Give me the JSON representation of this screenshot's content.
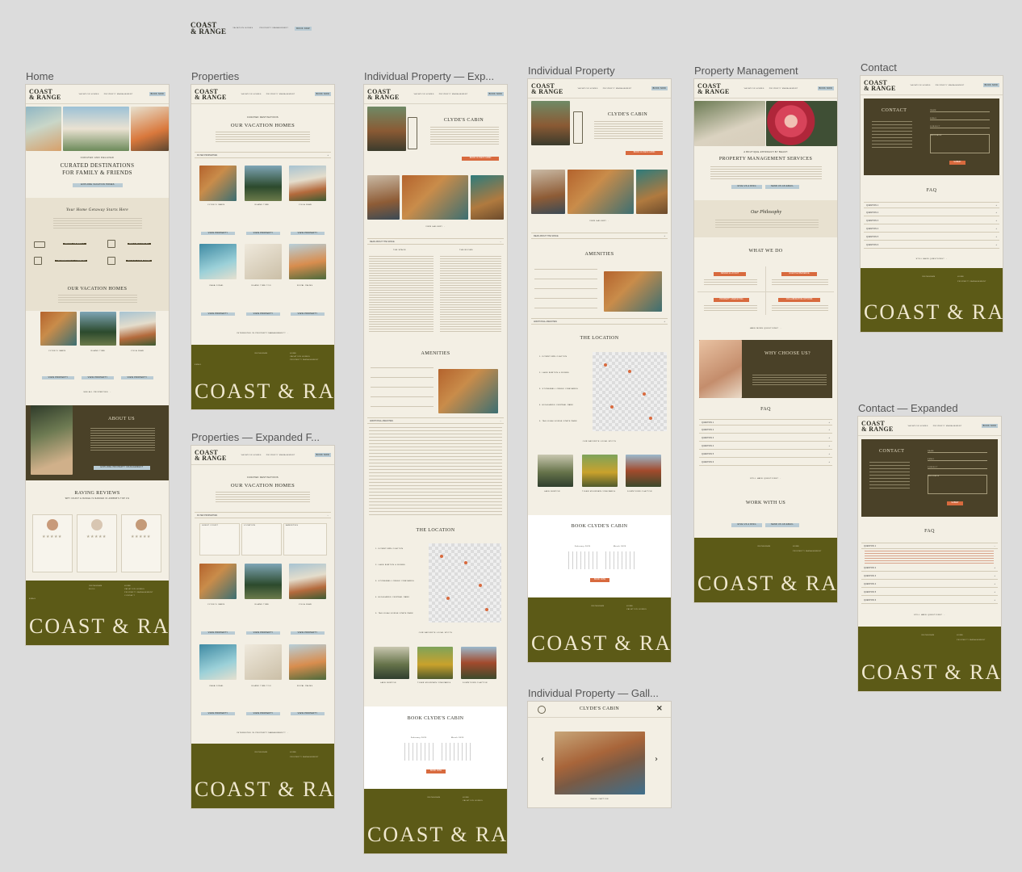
{
  "brand": {
    "logo_line1": "COAST",
    "logo_line2": "& RANGE"
  },
  "top_nav": {
    "links": [
      "VACATION HOMES",
      "PROPERTY MANAGEMENT"
    ],
    "book_now": "BOOK NOW"
  },
  "frames": [
    {
      "label": "Home"
    },
    {
      "label": "Properties"
    },
    {
      "label": "Individual Property — Exp..."
    },
    {
      "label": "Individual Property"
    },
    {
      "label": "Property Management"
    },
    {
      "label": "Contact"
    },
    {
      "label": "Properties — Expanded F..."
    },
    {
      "label": "Individual Property — Gall..."
    },
    {
      "label": "Contact — Expanded"
    }
  ],
  "home": {
    "eyebrow": "CURATED AND RELAXED",
    "hero_title_1": "CURATED DESTINATIONS",
    "hero_title_2": "FOR FAMILY & FRIENDS",
    "hero_cta": "EXPLORE VACATION HOMES",
    "script_line": "Your Home Getaway Starts Here",
    "features": [
      "GROUP FRIENDLY",
      "PET FRIENDLY",
      "WELL APPOINTED",
      "THOUGHTFULLY CURATED",
      "STELLAR HOSTS",
      "IDYLLIC LOCATIONS"
    ],
    "homes_title": "OUR VACATION HOMES",
    "view_all": "SEE ALL PROPERTIES →",
    "about_title": "ABOUT US",
    "about_cta": "EXPLORE PROPERTY MANAGEMENT",
    "reviews_title": "RAVING REVIEWS",
    "reviews_sub": "WHY COAST & RANGE IS RANKED IN AIRBNB'S TOP 1%",
    "stars": "★★★★★"
  },
  "properties": {
    "eyebrow": "CURATED DESTINATIONS",
    "title": "OUR VACATION HOMES",
    "filter": "FILTER PROPERTIES",
    "filter_columns": [
      "GUEST COUNT",
      "LOCATION",
      "AMENITIES"
    ],
    "cards": [
      "CLYDE'S CABIN",
      "ISLAND TIME",
      "VILLA JEAN",
      "CASA CORAL",
      "ISLAND TIME TOO",
      "ROYAL PALMS"
    ],
    "view_property": "VIEW PROPERTY",
    "pm_link": "INTERESTED IN PROPERTY MANAGEMENT? →"
  },
  "property": {
    "title": "CLYDE'S CABIN",
    "book_cta": "BOOK CLYDE'S CABIN",
    "gallery_link": "VIEW GALLERY →",
    "read_about": "READ ABOUT THE SPACE",
    "the_space": "THE SPACE",
    "the_rooms": "THE ROOMS",
    "amenities_title": "AMENITIES",
    "additional_amenities": "ADDITIONAL AMENITIES",
    "location_title": "THE LOCATION",
    "locations": [
      "1. DOWNTOWN CLAYTON",
      "2. LAKE BURTON & ROBBS",
      "3. STONEWALL CREEK VINEYARDS",
      "4. HIGHLANDS CENTRAL PARK",
      "5. TALLULAH GORGE STATE PARK"
    ],
    "favorite_spots": "OUR FAVORITE LOCAL SPOTS",
    "spots": [
      "LAKE BURTON",
      "TIGER MOUNTAIN VINEYARDS",
      "DOWNTOWN CLAYTON"
    ],
    "book_title": "BOOK CLYDE'S CABIN",
    "months": [
      "February 2025",
      "March 2025"
    ],
    "book_btn": "BOOK NOW"
  },
  "pm": {
    "eyebrow": "A BOUTIQUE APPROACH BY BEACH",
    "title": "PROPERTY MANAGEMENT SERVICES",
    "cta_1": "GIVE US A RING",
    "cta_2": "SEND US AN EMAIL",
    "philosophy": "Our Philosophy",
    "what_we_do": "WHAT WE DO",
    "services": [
      "DESIGN & LAYOUT",
      "GUEST EXPERIENCE",
      "PROPERTY MARKETING",
      "COLLABORATIVE OPTIONS"
    ],
    "more_questions": "HAVE MORE QUESTIONS? →",
    "why_title": "WHY CHOOSE US?",
    "faq": "FAQ",
    "questions": [
      "QUESTION 1",
      "QUESTION 2",
      "QUESTION 3",
      "QUESTION 4",
      "QUESTION 5",
      "QUESTION 6"
    ],
    "still_questions": "STILL HAVE QUESTIONS? →",
    "work_with_us": "WORK WITH US"
  },
  "contact": {
    "title": "CONTACT",
    "fields": [
      "NAME",
      "EMAIL",
      "SUBJECT",
      "MESSAGE"
    ],
    "submit": "SUBMIT",
    "faq": "FAQ"
  },
  "gallery": {
    "title": "CLYDE'S CABIN",
    "close": "×",
    "prev": "‹",
    "next": "›",
    "caption": "IMAGE CAPTION"
  },
  "footer": {
    "wordmark": "COAST & RANGE",
    "col_social": [
      "INSTAGRAM",
      "FAQ",
      "BLOG"
    ],
    "col_links": [
      "HOME",
      "VACATION HOMES",
      "PROPERTY MANAGEMENT",
      "CONTACT"
    ],
    "email_label": "EMAIL"
  },
  "colors": {
    "canvas": "#dcdcdc",
    "cream": "#f3efe4",
    "olive": "#5c5a17",
    "dark": "#4a4128",
    "accent_blue": "#b9cbd4",
    "accent_orange": "#d86a3e"
  }
}
